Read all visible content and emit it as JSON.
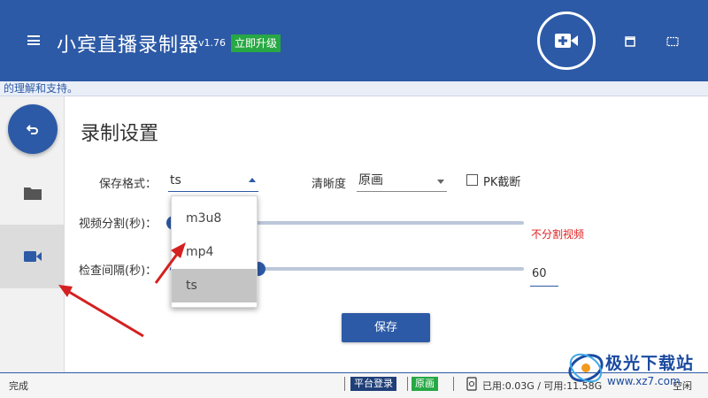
{
  "colors": {
    "primary": "#2d5aa6",
    "green": "#27a844",
    "red": "#e02020",
    "annotation_arrow": "#d42020"
  },
  "header": {
    "title": "小宾直播录制器",
    "version": "v1.76",
    "upgrade_label": "立即升级",
    "icons": [
      "menu-icon",
      "add-video-icon",
      "window-restore-icon",
      "window-maximize-icon"
    ]
  },
  "marquee": {
    "text": "的理解和支持。"
  },
  "sidebar": {
    "icons": [
      "back-icon",
      "folder-icon",
      "video-icon"
    ]
  },
  "main": {
    "section_title": "录制设置",
    "format_label": "保存格式：",
    "format_value": "ts",
    "quality_label": "清晰度",
    "quality_value": "原画",
    "pk_label": "PK截断",
    "pk_checked": false,
    "split_label": "视频分割(秒)：",
    "split_note": "不分割视频",
    "interval_label": "检查间隔(秒)：",
    "interval_value": "60",
    "interval_slider_fraction": 0.25,
    "save_label": "保存"
  },
  "dropdown": {
    "options": [
      "m3u8",
      "mp4",
      "ts"
    ],
    "selected": "ts"
  },
  "statusbar": {
    "status": "完成",
    "platform_login": "平台登录",
    "quality": "原画",
    "disk_usage": "已用:0.03G / 可用:11.58G",
    "idle": "空闲"
  },
  "watermark": {
    "text": "极光下载站",
    "url": "www.xz7.com"
  }
}
